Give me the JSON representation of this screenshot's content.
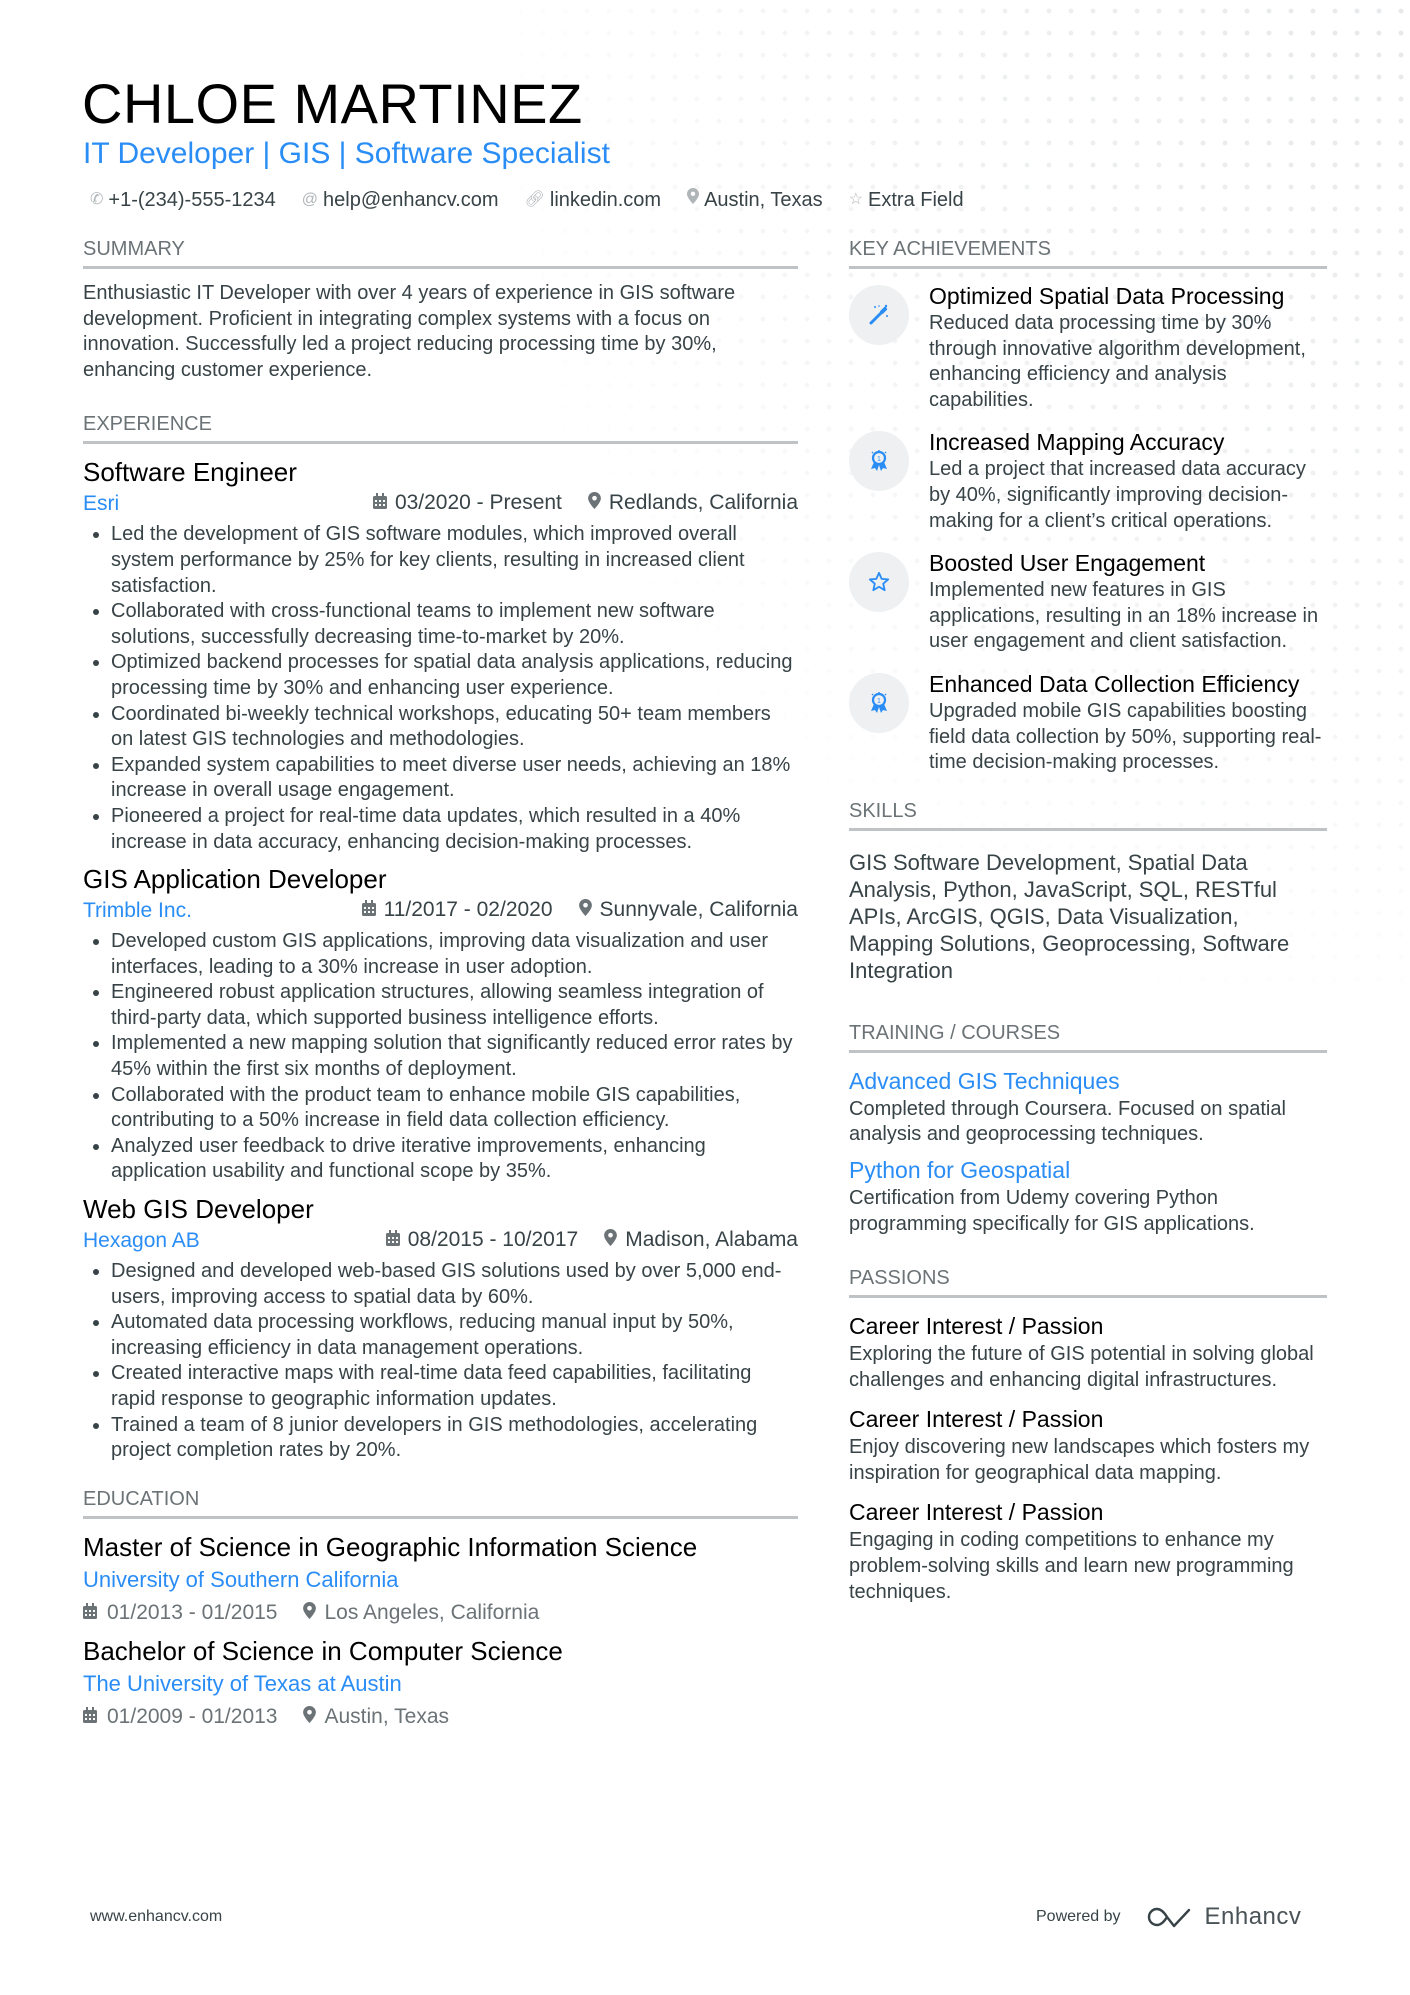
{
  "header": {
    "name": "CHLOE MARTINEZ",
    "title": "IT Developer | GIS | Software Specialist",
    "contacts": [
      {
        "icon": "phone-icon",
        "text": "+1-(234)-555-1234"
      },
      {
        "icon": "at-icon",
        "text": "help@enhancv.com"
      },
      {
        "icon": "link-icon",
        "text": "linkedin.com"
      },
      {
        "icon": "location-pin-icon",
        "text": "Austin, Texas"
      },
      {
        "icon": "star-icon",
        "text": "Extra Field"
      }
    ]
  },
  "summary": {
    "heading": "SUMMARY",
    "text": "Enthusiastic IT Developer with over 4 years of experience in GIS software development. Proficient in integrating complex systems with a focus on innovation. Successfully led a project reducing processing time by 30%, enhancing customer experience."
  },
  "experience": {
    "heading": "EXPERIENCE",
    "jobs": [
      {
        "title": "Software Engineer",
        "company": "Esri",
        "dates": "03/2020 - Present",
        "location": "Redlands, California",
        "bullets": [
          "Led the development of GIS software modules, which improved overall system performance by 25% for key clients, resulting in increased client satisfaction.",
          "Collaborated with cross-functional teams to implement new software solutions, successfully decreasing time-to-market by 20%.",
          "Optimized backend processes for spatial data analysis applications, reducing processing time by 30% and enhancing user experience.",
          "Coordinated bi-weekly technical workshops, educating 50+ team members on latest GIS technologies and methodologies.",
          "Expanded system capabilities to meet diverse user needs, achieving an 18% increase in overall usage engagement.",
          "Pioneered a project for real-time data updates, which resulted in a 40% increase in data accuracy, enhancing decision-making processes."
        ]
      },
      {
        "title": "GIS Application Developer",
        "company": "Trimble Inc.",
        "dates": "11/2017 - 02/2020",
        "location": "Sunnyvale, California",
        "bullets": [
          "Developed custom GIS applications, improving data visualization and user interfaces, leading to a 30% increase in user adoption.",
          "Engineered robust application structures, allowing seamless integration of third-party data, which supported business intelligence efforts.",
          "Implemented a new mapping solution that significantly reduced error rates by 45% within the first six months of deployment.",
          "Collaborated with the product team to enhance mobile GIS capabilities, contributing to a 50% increase in field data collection efficiency.",
          "Analyzed user feedback to drive iterative improvements, enhancing application usability and functional scope by 35%."
        ]
      },
      {
        "title": "Web GIS Developer",
        "company": "Hexagon AB",
        "dates": "08/2015 - 10/2017",
        "location": "Madison, Alabama",
        "bullets": [
          "Designed and developed web-based GIS solutions used by over 5,000 end-users, improving access to spatial data by 60%.",
          "Automated data processing workflows, reducing manual input by 50%, increasing efficiency in data management operations.",
          "Created interactive maps with real-time data feed capabilities, facilitating rapid response to geographic information updates.",
          "Trained a team of 8 junior developers in GIS methodologies, accelerating project completion rates by 20%."
        ]
      }
    ]
  },
  "education": {
    "heading": "EDUCATION",
    "items": [
      {
        "degree": "Master of Science in Geographic Information Science",
        "school": "University of Southern California",
        "dates": "01/2013 - 01/2015",
        "location": "Los Angeles, California"
      },
      {
        "degree": "Bachelor of Science in Computer Science",
        "school": "The University of Texas at Austin",
        "dates": "01/2009 - 01/2013",
        "location": "Austin, Texas"
      }
    ]
  },
  "achievements": {
    "heading": "KEY ACHIEVEMENTS",
    "items": [
      {
        "icon": "magic-wand-icon",
        "title": "Optimized Spatial Data Processing",
        "text": "Reduced data processing time by 30% through innovative algorithm development, enhancing efficiency and analysis capabilities."
      },
      {
        "icon": "award-ribbon-icon",
        "title": "Increased Mapping Accuracy",
        "text": "Led a project that increased data accuracy by 40%, significantly improving decision-making for a client’s critical operations."
      },
      {
        "icon": "star-icon",
        "title": "Boosted User Engagement",
        "text": "Implemented new features in GIS applications, resulting in an 18% increase in user engagement and client satisfaction."
      },
      {
        "icon": "award-ribbon-icon",
        "title": "Enhanced Data Collection Efficiency",
        "text": "Upgraded mobile GIS capabilities boosting field data collection by 50%, supporting real-time decision-making processes."
      }
    ]
  },
  "skills": {
    "heading": "SKILLS",
    "text": "GIS Software Development, Spatial Data Analysis, Python, JavaScript, SQL, RESTful APIs, ArcGIS, QGIS, Data Visualization, Mapping Solutions, Geoprocessing, Software Integration"
  },
  "training": {
    "heading": "TRAINING / COURSES",
    "items": [
      {
        "title": "Advanced GIS Techniques",
        "text": "Completed through Coursera. Focused on spatial analysis and geoprocessing techniques."
      },
      {
        "title": "Python for Geospatial",
        "text": "Certification from Udemy covering Python programming specifically for GIS applications."
      }
    ]
  },
  "passions": {
    "heading": "PASSIONS",
    "items": [
      {
        "title": "Career Interest / Passion",
        "text": "Exploring the future of GIS potential in solving global challenges and enhancing digital infrastructures."
      },
      {
        "title": "Career Interest / Passion",
        "text": "Enjoy discovering new landscapes which fosters my inspiration for geographical data mapping."
      },
      {
        "title": "Career Interest / Passion",
        "text": "Engaging in coding competitions to enhance my problem-solving skills and learn new programming techniques."
      }
    ]
  },
  "footer": {
    "website": "www.enhancv.com",
    "powered_by": "Powered by",
    "brand": "Enhancv"
  },
  "colors": {
    "accent": "#2a8df5",
    "text": "#384347",
    "heading_rule": "#bfc3c6"
  }
}
